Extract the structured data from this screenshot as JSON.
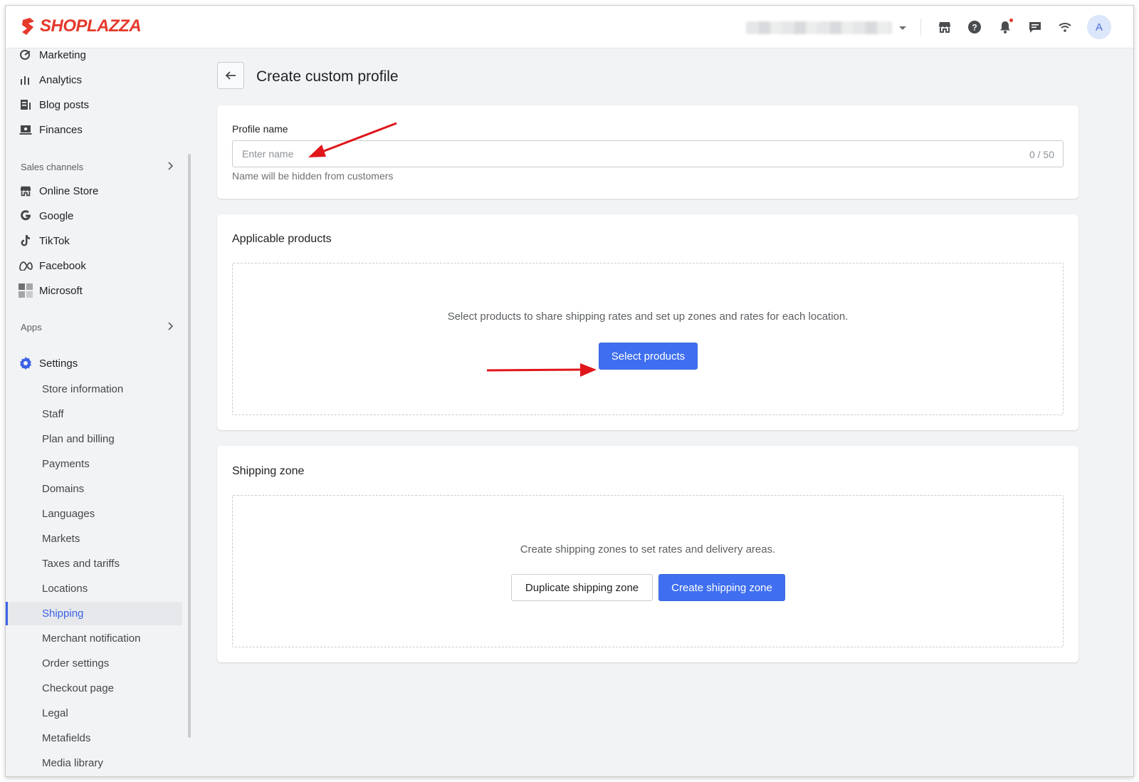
{
  "brand": {
    "name": "SHOPLAZZA",
    "color": "#e5392b"
  },
  "header": {
    "icons": [
      "store-icon",
      "help-icon",
      "bell-icon",
      "chat-icon",
      "wifi-icon"
    ],
    "avatar_initial": "A"
  },
  "sidebar": {
    "top_items": [
      {
        "label": "Marketing",
        "icon": "marketing-icon"
      },
      {
        "label": "Analytics",
        "icon": "analytics-icon"
      },
      {
        "label": "Blog posts",
        "icon": "blog-icon"
      },
      {
        "label": "Finances",
        "icon": "finances-icon"
      }
    ],
    "sales_channels_label": "Sales channels",
    "channels": [
      {
        "label": "Online Store",
        "icon": "store-icon"
      },
      {
        "label": "Google",
        "icon": "google-icon"
      },
      {
        "label": "TikTok",
        "icon": "tiktok-icon"
      },
      {
        "label": "Facebook",
        "icon": "meta-icon"
      },
      {
        "label": "Microsoft",
        "icon": "microsoft-icon"
      }
    ],
    "apps_label": "Apps",
    "settings_label": "Settings",
    "settings_items": [
      "Store information",
      "Staff",
      "Plan and billing",
      "Payments",
      "Domains",
      "Languages",
      "Markets",
      "Taxes and tariffs",
      "Locations",
      "Shipping",
      "Merchant notification",
      "Order settings",
      "Checkout page",
      "Legal",
      "Metafields",
      "Media library"
    ],
    "active_item": "Shipping"
  },
  "page": {
    "title": "Create custom profile",
    "profile": {
      "label": "Profile name",
      "placeholder": "Enter name",
      "value": "",
      "counter": "0 / 50",
      "help": "Name will be hidden from customers"
    },
    "products": {
      "title": "Applicable products",
      "empty_text": "Select products to share shipping rates and set up zones and rates for each location.",
      "select_button": "Select products"
    },
    "shipping_zone": {
      "title": "Shipping zone",
      "empty_text": "Create shipping zones to set rates and delivery areas.",
      "duplicate_button": "Duplicate shipping zone",
      "create_button": "Create shipping zone"
    }
  },
  "colors": {
    "accent": "#3f6ff0",
    "annotation_arrow": "#e0161b"
  }
}
